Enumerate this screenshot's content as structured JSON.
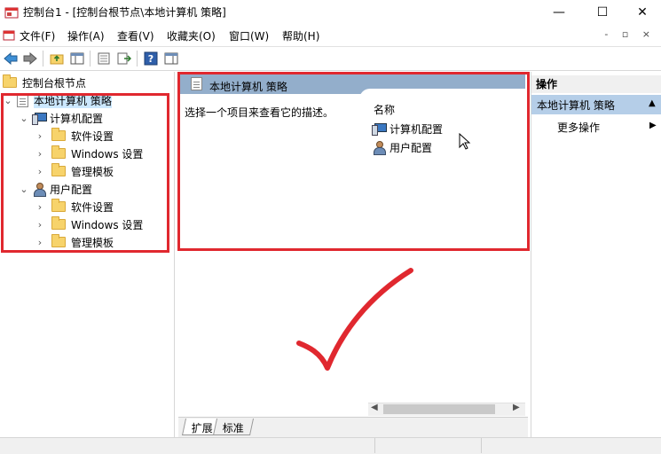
{
  "window": {
    "title": "控制台1 - [控制台根节点\\本地计算机 策略]",
    "minimize": "—",
    "maximize": "☐",
    "close": "✕"
  },
  "menu": {
    "items": [
      "文件(F)",
      "操作(A)",
      "查看(V)",
      "收藏夹(O)",
      "窗口(W)",
      "帮助(H)"
    ],
    "mdi": "- ▫ ×"
  },
  "tree": {
    "root": "控制台根节点",
    "policy": "本地计算机 策略",
    "computer_config": "计算机配置",
    "user_config": "用户配置",
    "children": [
      "软件设置",
      "Windows 设置",
      "管理模板"
    ]
  },
  "middle": {
    "header": "本地计算机 策略",
    "description": "选择一个项目来查看它的描述。",
    "column_name": "名称",
    "items": [
      "计算机配置",
      "用户配置"
    ],
    "tabs": [
      "扩展",
      "标准"
    ]
  },
  "actions": {
    "header": "操作",
    "selected": "本地计算机 策略",
    "more": "更多操作"
  },
  "colors": {
    "annotation_red": "#e0282f",
    "header_blue": "#93aecb",
    "selection": "#b5cee8"
  }
}
